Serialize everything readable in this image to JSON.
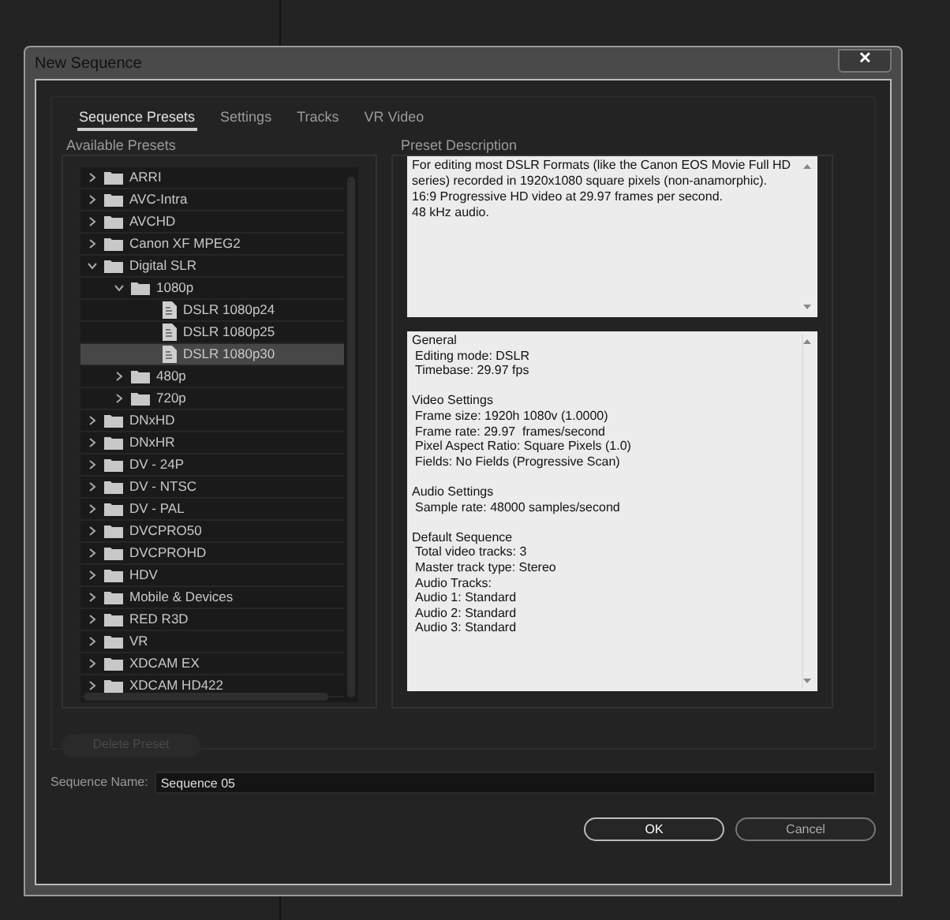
{
  "window": {
    "title": "New Sequence",
    "close": "✕"
  },
  "tabs": [
    {
      "label": "Sequence Presets",
      "selected": true
    },
    {
      "label": "Settings",
      "selected": false
    },
    {
      "label": "Tracks",
      "selected": false
    },
    {
      "label": "VR Video",
      "selected": false
    }
  ],
  "presets": {
    "title": "Available Presets",
    "items": [
      {
        "kind": "folder",
        "label": "ARRI",
        "expanded": false,
        "selected": false
      },
      {
        "kind": "folder",
        "label": "AVC-Intra",
        "expanded": false,
        "selected": false
      },
      {
        "kind": "folder",
        "label": "AVCHD",
        "expanded": false,
        "selected": false
      },
      {
        "kind": "folder",
        "label": "Canon XF MPEG2",
        "expanded": false,
        "selected": false
      },
      {
        "kind": "folder",
        "label": "Digital SLR",
        "expanded": true,
        "selected": false,
        "children": [
          {
            "kind": "folder",
            "label": "1080p",
            "expanded": true,
            "selected": false,
            "children": [
              {
                "kind": "preset",
                "label": "DSLR 1080p24",
                "selected": false
              },
              {
                "kind": "preset",
                "label": "DSLR 1080p25",
                "selected": false
              },
              {
                "kind": "preset",
                "label": "DSLR 1080p30",
                "selected": true
              }
            ]
          },
          {
            "kind": "folder",
            "label": "480p",
            "expanded": false,
            "selected": false
          },
          {
            "kind": "folder",
            "label": "720p",
            "expanded": false,
            "selected": false
          }
        ]
      },
      {
        "kind": "folder",
        "label": "DNxHD",
        "expanded": false,
        "selected": false
      },
      {
        "kind": "folder",
        "label": "DNxHR",
        "expanded": false,
        "selected": false
      },
      {
        "kind": "folder",
        "label": "DV - 24P",
        "expanded": false,
        "selected": false
      },
      {
        "kind": "folder",
        "label": "DV - NTSC",
        "expanded": false,
        "selected": false
      },
      {
        "kind": "folder",
        "label": "DV - PAL",
        "expanded": false,
        "selected": false
      },
      {
        "kind": "folder",
        "label": "DVCPRO50",
        "expanded": false,
        "selected": false
      },
      {
        "kind": "folder",
        "label": "DVCPROHD",
        "expanded": false,
        "selected": false
      },
      {
        "kind": "folder",
        "label": "HDV",
        "expanded": false,
        "selected": false
      },
      {
        "kind": "folder",
        "label": "Mobile & Devices",
        "expanded": false,
        "selected": false
      },
      {
        "kind": "folder",
        "label": "RED R3D",
        "expanded": false,
        "selected": false
      },
      {
        "kind": "folder",
        "label": "VR",
        "expanded": false,
        "selected": false
      },
      {
        "kind": "folder",
        "label": "XDCAM EX",
        "expanded": false,
        "selected": false
      },
      {
        "kind": "folder",
        "label": "XDCAM HD422",
        "expanded": false,
        "selected": false
      }
    ],
    "delete_button": {
      "label": "Delete Preset",
      "disabled": true
    }
  },
  "description": {
    "title": "Preset Description",
    "text": "For editing most DSLR Formats (like the Canon EOS Movie Full HD series) recorded in 1920x1080 square pixels (non-anamorphic).\n16:9 Progressive HD video at 29.97 frames per second.\n48 kHz audio."
  },
  "summary": [
    {
      "heading": "General",
      "lines": [
        "Editing mode: DSLR",
        "Timebase: 29.97 fps"
      ]
    },
    {
      "heading": "Video Settings",
      "lines": [
        "Frame size: 1920h 1080v (1.0000)",
        "Frame rate: 29.97  frames/second",
        "Pixel Aspect Ratio: Square Pixels (1.0)",
        "Fields: No Fields (Progressive Scan)"
      ]
    },
    {
      "heading": "Audio Settings",
      "lines": [
        "Sample rate: 48000 samples/second"
      ]
    },
    {
      "heading": "Default Sequence",
      "lines": [
        "Total video tracks: 3",
        "Master track type: Stereo",
        "Audio Tracks:",
        "Audio 1: Standard",
        "Audio 2: Standard",
        "Audio 3: Standard"
      ]
    }
  ],
  "sequence_name": {
    "label": "Sequence Name:",
    "value": "Sequence 05"
  },
  "buttons": [
    {
      "label": "OK",
      "kind": "primary"
    },
    {
      "label": "Cancel",
      "kind": "secondary"
    }
  ]
}
